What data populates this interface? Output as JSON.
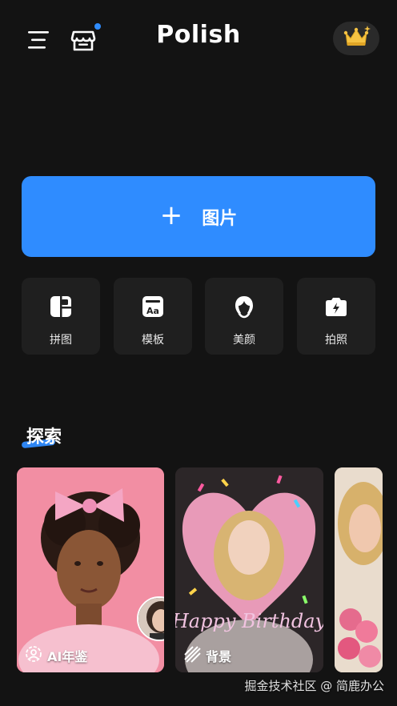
{
  "header": {
    "app_title": "Polish",
    "menu_icon": "menu-icon",
    "store_icon": "store-icon",
    "premium_icon": "crown-icon",
    "notification_color": "#2F8CFF"
  },
  "main": {
    "add_button_label": "图片",
    "add_icon": "plus-icon",
    "accent": "#2F8CFF"
  },
  "tools": [
    {
      "label": "拼图",
      "icon": "collage-icon"
    },
    {
      "label": "模板",
      "icon": "template-icon"
    },
    {
      "label": "美颜",
      "icon": "beauty-icon"
    },
    {
      "label": "拍照",
      "icon": "camera-icon"
    }
  ],
  "explore": {
    "title": "探索",
    "cards": [
      {
        "label": "AI年鉴",
        "icon": "ai-face-icon"
      },
      {
        "label": "背景",
        "icon": "background-icon",
        "artwork_text": "Happy Birthday"
      },
      {
        "label": "",
        "icon": ""
      }
    ]
  },
  "watermark": "掘金技术社区 @ 简鹿办公"
}
